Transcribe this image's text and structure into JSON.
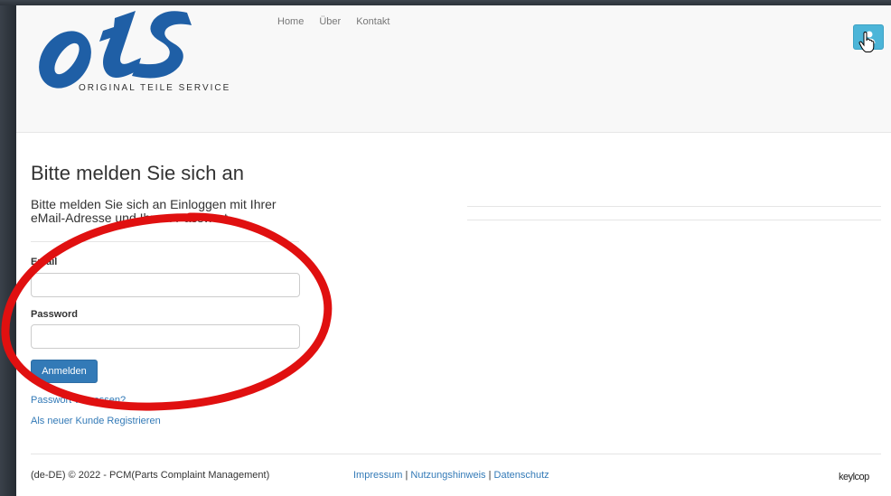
{
  "header": {
    "logo_text": "OtS",
    "logo_tagline": "ORIGINAL TEILE SERVICE",
    "nav": [
      "Home",
      "Über",
      "Kontakt"
    ],
    "user_button_icon": "user-icon"
  },
  "login": {
    "title": "Bitte melden Sie sich an",
    "intro": "Bitte melden Sie sich an Einloggen mit Ihrer eMail-Adresse und Ihrem Passwort",
    "email_label": "Email",
    "email_value": "",
    "password_label": "Password",
    "password_value": "",
    "submit_label": "Anmelden",
    "forgot_link": "Passwort vergessen?",
    "register_link": "Als neuer Kunde Registrieren"
  },
  "footer": {
    "copyright": "(de-DE) © 2022 - PCM(Parts Complaint Management)",
    "links": [
      "Impressum",
      "Nutzungshinweis",
      "Datenschutz"
    ],
    "separator": " | ",
    "brand": "keylcop"
  },
  "colors": {
    "primary": "#337ab7",
    "user_button": "#4cb5d8",
    "logo_blue": "#1f5fa6",
    "annotation_red": "#e01010"
  }
}
